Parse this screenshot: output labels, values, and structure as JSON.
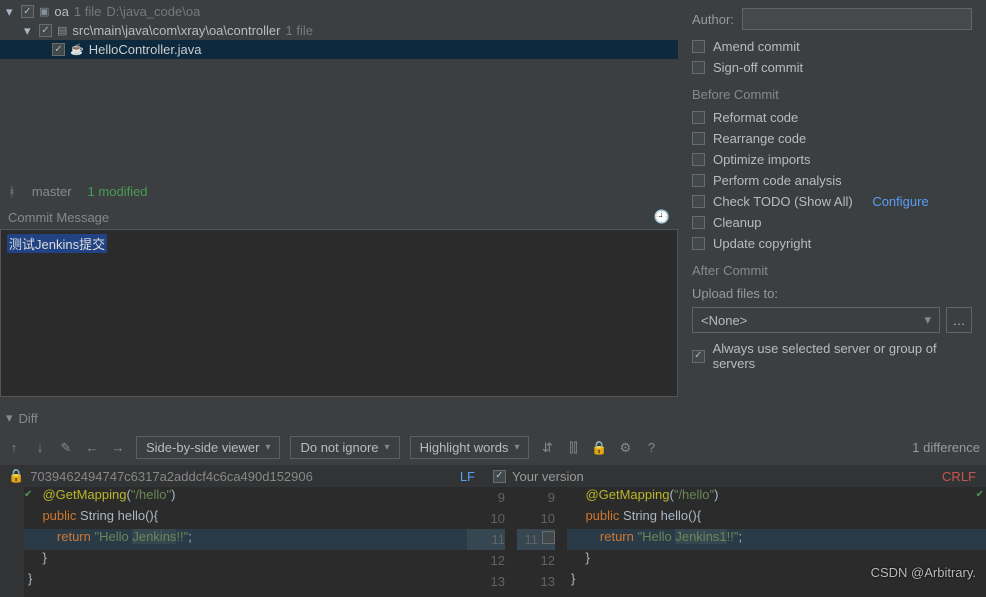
{
  "tree": {
    "root": {
      "name": "oa",
      "files": "1 file",
      "path": "D:\\java_code\\oa"
    },
    "sub": {
      "name": "src\\main\\java\\com\\xray\\oa\\controller",
      "files": "1 file"
    },
    "file": {
      "name": "HelloController.java"
    }
  },
  "branch": {
    "icon": "ᚼ",
    "name": "master",
    "modified": "1 modified"
  },
  "commit": {
    "header": "Commit Message",
    "text": "测试Jenkins提交"
  },
  "right": {
    "author_label": "Author:",
    "amend": "Amend commit",
    "signoff": "Sign-off commit",
    "before": "Before Commit",
    "reformat": "Reformat code",
    "rearrange": "Rearrange code",
    "optimize": "Optimize imports",
    "analysis": "Perform code analysis",
    "todo": "Check TODO (Show All)",
    "configure": "Configure",
    "cleanup": "Cleanup",
    "copyright": "Update copyright",
    "after": "After Commit",
    "upload": "Upload files to:",
    "upload_val": "<None>",
    "always": "Always use selected server or group of servers"
  },
  "diff": {
    "title": "Diff",
    "viewer": "Side-by-side viewer",
    "ignore": "Do not ignore",
    "highlight": "Highlight words",
    "count": "1 difference",
    "hash": "7039462494747c6317a2addcf4c6ca490d152906",
    "lf": "LF",
    "your": "Your version",
    "crlf": "CRLF",
    "left_lines": {
      "l1a": "@GetMapping",
      "l1b": "(",
      "l1c": "\"/hello\"",
      "l1d": ")",
      "l2a": "public ",
      "l2b": "String hello(){",
      "l3a": "    return ",
      "l3b": "\"Hello ",
      "l3c": "Jenkins",
      "l3d": "!!\"",
      "l3e": ";",
      "l4": "}",
      "l5": "}"
    },
    "right_lines": {
      "l1a": "@GetMapping",
      "l1b": "(",
      "l1c": "\"/hello\"",
      "l1d": ")",
      "l2a": "public ",
      "l2b": "String hello(){",
      "l3a": "    return ",
      "l3b": "\"Hello ",
      "l3c": "Jenkins1",
      "l3d": "!!\"",
      "l3e": ";",
      "l4": "}",
      "l5": "}"
    },
    "nums_left": [
      "9",
      "10",
      "11",
      "12",
      "13"
    ],
    "nums_right": [
      "9",
      "10",
      "11",
      "12",
      "13"
    ]
  },
  "watermark": "CSDN @Arbitrary."
}
